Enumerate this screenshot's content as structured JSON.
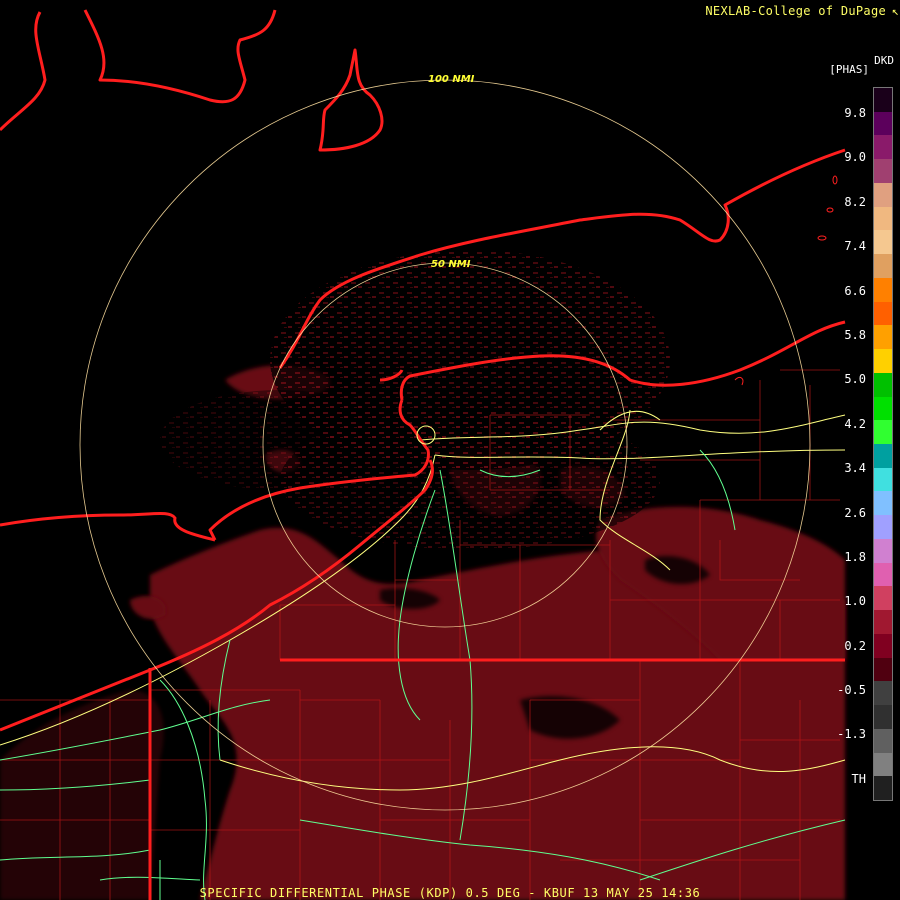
{
  "credit": "NEXLAB-College of DuPage",
  "credit_mark": "↖",
  "product_code": "DKD",
  "units": "[PHAS]",
  "footer": "SPECIFIC DIFFERENTIAL PHASE (KDP) 0.5 DEG - KBUF 13 MAY 25 14:36",
  "range_rings": [
    {
      "label": "100 NMI"
    },
    {
      "label": "50 NMI"
    }
  ],
  "legend": {
    "ticks": [
      "9.8",
      "9.0",
      "8.2",
      "7.4",
      "6.6",
      "5.8",
      "5.0",
      "4.2",
      "3.4",
      "2.6",
      "1.8",
      "1.0",
      "0.2",
      "-0.5",
      "-1.3",
      "TH"
    ],
    "colors": [
      "#1a001a",
      "#5c005c",
      "#8a1a6a",
      "#a04070",
      "#e0a080",
      "#f0b880",
      "#f5c890",
      "#e0a060",
      "#ff8000",
      "#ff6000",
      "#ffa000",
      "#ffd000",
      "#00c000",
      "#00e000",
      "#30ff30",
      "#00a0a0",
      "#40e0e0",
      "#80c0ff",
      "#a0a0ff",
      "#d080d0",
      "#e060b0",
      "#d04060",
      "#a01830",
      "#800020",
      "#500010",
      "#404040",
      "#303030",
      "#606060",
      "#808080",
      "#202020"
    ]
  }
}
